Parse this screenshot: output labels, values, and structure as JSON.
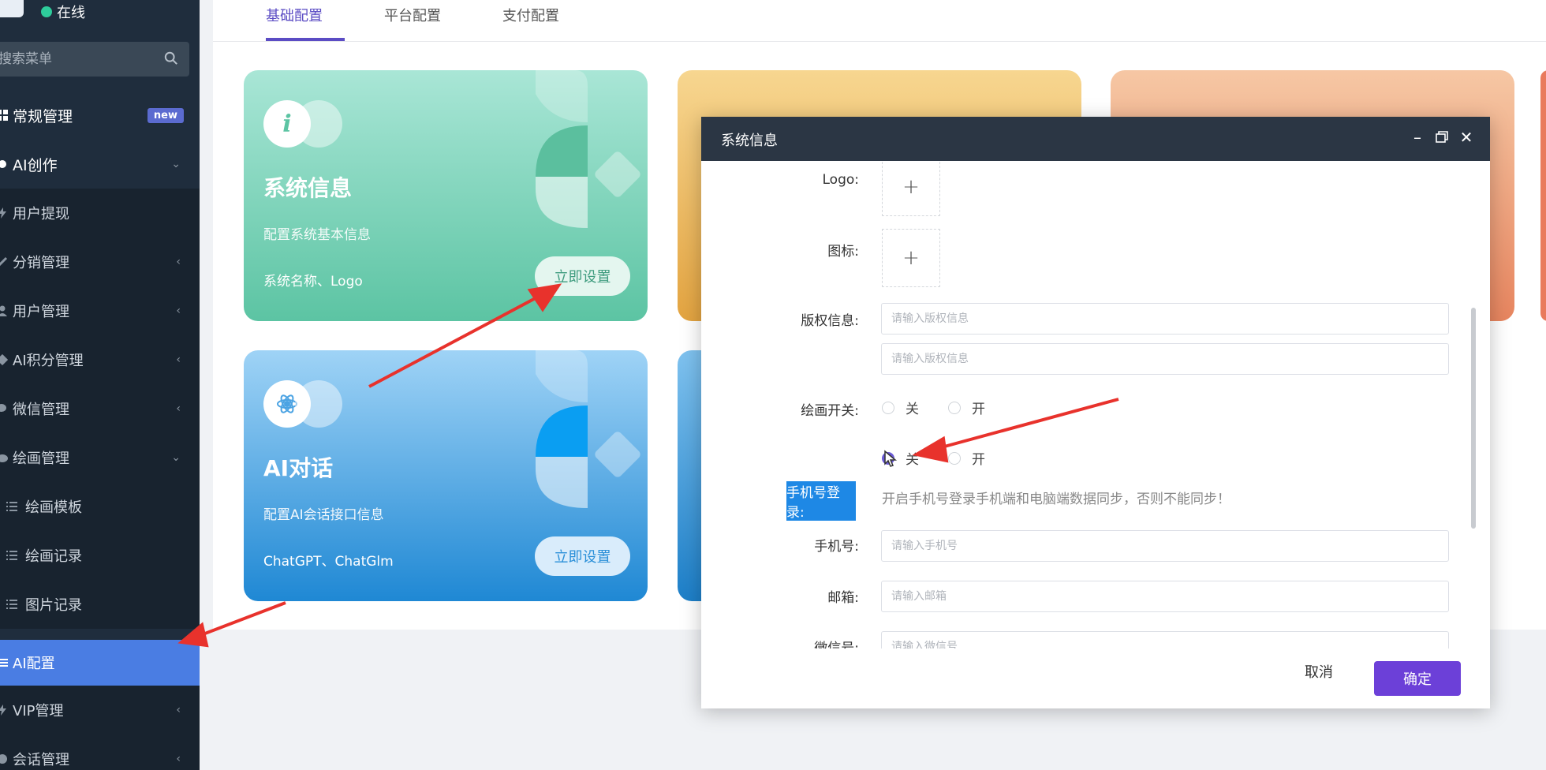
{
  "sidebar": {
    "status": "在线",
    "search_placeholder": "搜索菜单",
    "items": [
      {
        "label": "常规管理",
        "badge": "new"
      },
      {
        "label": "AI创作"
      },
      {
        "label": "用户提现"
      },
      {
        "label": "分销管理"
      },
      {
        "label": "用户管理"
      },
      {
        "label": "AI积分管理"
      },
      {
        "label": "微信管理"
      },
      {
        "label": "绘画管理"
      },
      {
        "label": "绘画模板"
      },
      {
        "label": "绘画记录"
      },
      {
        "label": "图片记录"
      },
      {
        "label": "AI配置"
      },
      {
        "label": "VIP管理"
      },
      {
        "label": "会话管理"
      }
    ]
  },
  "tabs": [
    {
      "label": "基础配置"
    },
    {
      "label": "平台配置"
    },
    {
      "label": "支付配置"
    }
  ],
  "cards": [
    {
      "title": "系统信息",
      "desc": "配置系统基本信息",
      "foot": "系统名称、Logo",
      "button": "立即设置"
    },
    {
      "title": "AI对话",
      "desc": "配置AI会话接口信息",
      "foot": "ChatGPT、ChatGlm",
      "button": "立即设置"
    }
  ],
  "dialog": {
    "title": "系统信息",
    "labels": {
      "logo": "Logo:",
      "icon": "图标:",
      "copyright": "版权信息:",
      "draw_switch": "绘画开关:",
      "phone_login": "手机号登录:",
      "phone": "手机号:",
      "email": "邮箱:",
      "wechat": "微信号:"
    },
    "placeholders": {
      "copyright1": "请输入版权信息",
      "copyright2": "请输入版权信息",
      "phone": "请输入手机号",
      "email": "请输入邮箱",
      "wechat": "请输入微信号"
    },
    "radio_off": "关",
    "radio_on": "开",
    "hint": "开启手机号登录手机端和电脑端数据同步，否则不能同步！",
    "cancel": "取消",
    "confirm": "确定"
  },
  "colors": {
    "accent": "#6c40d8",
    "sidebar_bg": "#1f2d3d",
    "active_menu": "#4a7de3",
    "card_green": "#5cc4a3",
    "card_blue": "#2a8fd8"
  }
}
